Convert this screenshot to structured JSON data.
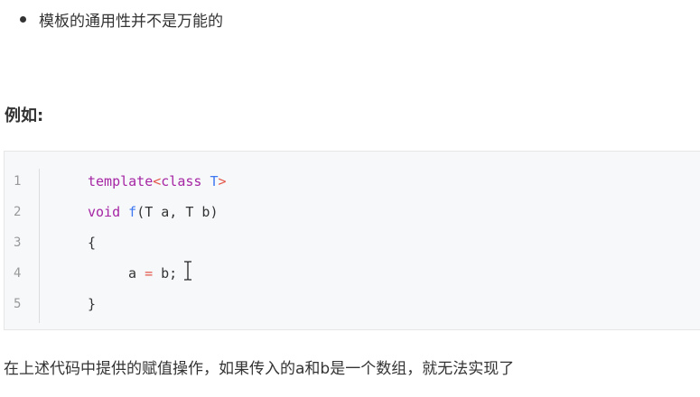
{
  "bullet": {
    "text": "模板的通用性并不是万能的"
  },
  "heading": {
    "text": "例如:"
  },
  "code": {
    "line_numbers": [
      "1",
      "2",
      "3",
      "4",
      "5"
    ],
    "line1": {
      "kw": "template",
      "op1": "<",
      "kw2": "class",
      "sp": " ",
      "ty": "T",
      "op2": ">"
    },
    "line2": {
      "kw": "void",
      "sp1": " ",
      "fn": "f",
      "rest": "(T a, T b)"
    },
    "line3": {
      "text": "{"
    },
    "line4": {
      "a": "a ",
      "op": "=",
      "b": " b;"
    },
    "line5": {
      "text": "}"
    }
  },
  "paragraph": {
    "text": "在上述代码中提供的赋值操作，如果传入的a和b是一个数组，就无法实现了"
  },
  "icons": {
    "cursor": "text-cursor-icon"
  }
}
